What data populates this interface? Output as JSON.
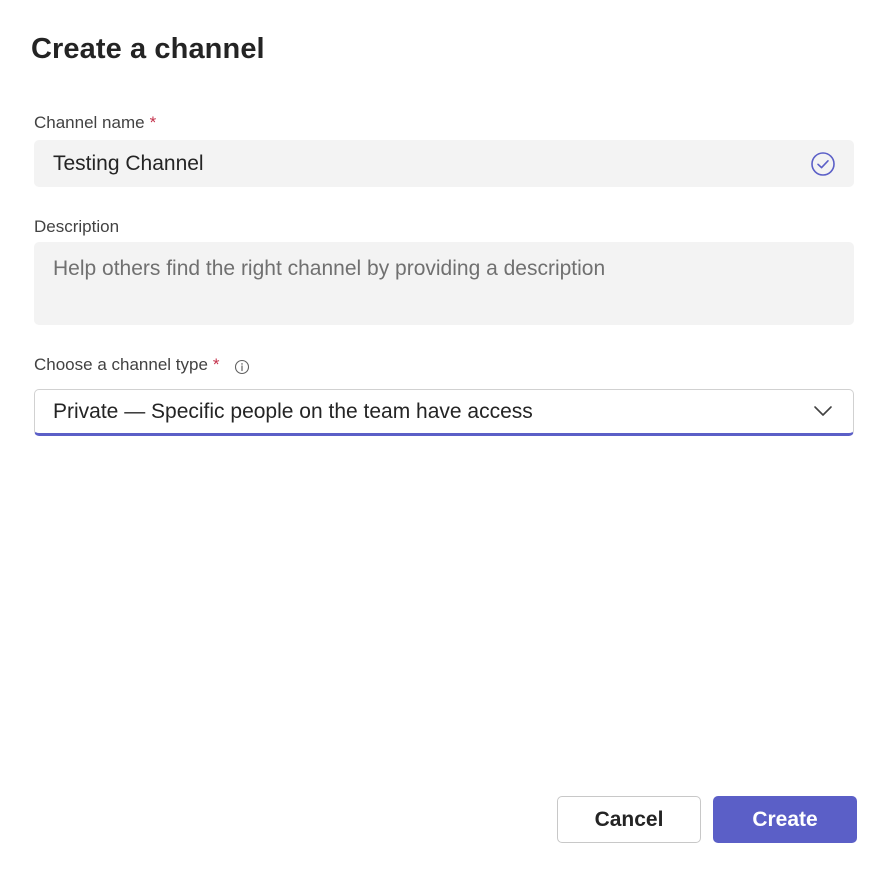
{
  "dialog": {
    "title": "Create a channel"
  },
  "channel_name": {
    "label": "Channel name",
    "required_mark": "*",
    "value": "Testing Channel",
    "status_icon": "checkmark-circle-icon"
  },
  "description": {
    "label": "Description",
    "placeholder": "Help others find the right channel by providing a description"
  },
  "channel_type": {
    "label": "Choose a channel type",
    "required_mark": "*",
    "info_icon": "info-icon",
    "selected": "Private — Specific people on the team have access",
    "dropdown_icon": "chevron-down-icon"
  },
  "actions": {
    "cancel_label": "Cancel",
    "create_label": "Create"
  },
  "colors": {
    "accent": "#5b5fc7",
    "required": "#c4314b",
    "input_bg": "#f3f3f3"
  }
}
